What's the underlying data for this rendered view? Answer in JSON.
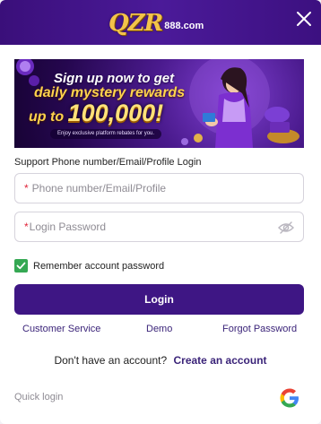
{
  "header": {
    "logo_main": "QZR",
    "logo_sub": "888.com"
  },
  "banner": {
    "line1": "Sign up now to get",
    "line2": "daily mystery rewards",
    "line3_prefix": "up to",
    "line3_amount": "100,000!",
    "tagline": "Enjoy exclusive platform rebates for you."
  },
  "form": {
    "login_label": "Support Phone number/Email/Profile Login",
    "phone_required": "*",
    "phone_placeholder": "Phone number/Email/Profile",
    "password_required": "*",
    "password_placeholder": "Login Password",
    "remember_label": "Remember account password",
    "remember_checked": true,
    "login_button": "Login"
  },
  "links": {
    "customer_service": "Customer Service",
    "demo": "Demo",
    "forgot_password": "Forgot Password"
  },
  "signup": {
    "question": "Don't have an account?",
    "create_link": "Create an account"
  },
  "quick_login": {
    "label": "Quick login",
    "google_icon": "google-icon"
  },
  "colors": {
    "header_bg": "#3a0f7a",
    "primary": "#3e1684",
    "link": "#3b2479",
    "checkbox": "#35a853",
    "required": "#e0253a"
  }
}
